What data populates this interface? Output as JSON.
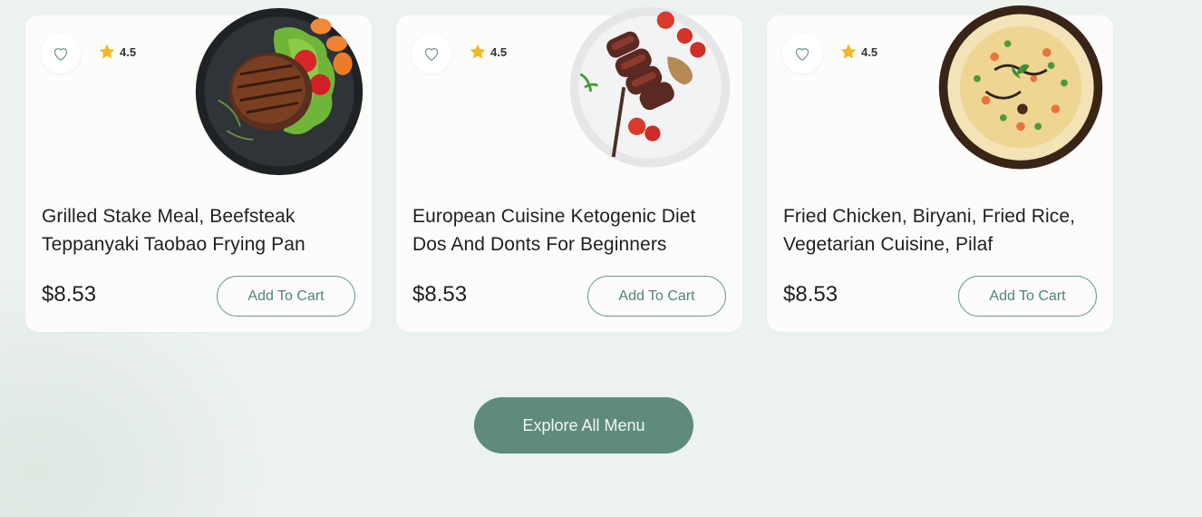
{
  "products": [
    {
      "title": "Grilled Stake Meal, Beefsteak Teppanyaki Taobao Frying Pan",
      "rating": "4.5",
      "price": "$8.53",
      "cart_label": "Add To Cart",
      "image": "grilled-steak-plate"
    },
    {
      "title": "European Cuisine Ketogenic Diet Dos And Donts For Beginners",
      "rating": "4.5",
      "price": "$8.53",
      "cart_label": "Add To Cart",
      "image": "sliced-steak-plate"
    },
    {
      "title": "Fried Chicken, Biryani, Fried Rice, Vegetarian Cuisine, Pilaf",
      "rating": "4.5",
      "price": "$8.53",
      "cart_label": "Add To Cart",
      "image": "biryani-bowl"
    }
  ],
  "explore_label": "Explore All Menu",
  "colors": {
    "accent": "#5f8b7b",
    "star": "#f2b81f",
    "background": "#ecf3ef",
    "card": "#fcfcfa"
  },
  "icons": {
    "favorite": "heart-outline-icon",
    "rating": "star-icon"
  }
}
